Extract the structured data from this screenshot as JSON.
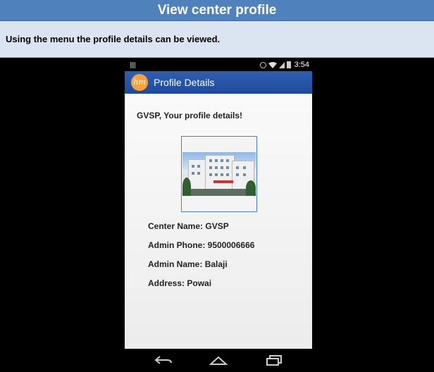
{
  "slide": {
    "title": "View center profile",
    "description": "Using the menu the profile details can be viewed."
  },
  "status_bar": {
    "time": "3:54",
    "icons": [
      "barcode-icon",
      "alarm-icon",
      "wifi-icon",
      "signal-icon",
      "battery-icon"
    ]
  },
  "action_bar": {
    "logo_text": "hm",
    "title": "Profile Details"
  },
  "profile": {
    "greeting": "GVSP, Your profile details!",
    "details": [
      {
        "label": "Center Name:",
        "value": "GVSP"
      },
      {
        "label": "Admin Phone:",
        "value": "9500006666"
      },
      {
        "label": "Admin Name:",
        "value": "Balaji"
      },
      {
        "label": "Address:",
        "value": "Powai"
      }
    ]
  },
  "nav_bar": {
    "buttons": [
      "back-icon",
      "home-icon",
      "recent-apps-icon"
    ]
  },
  "colors": {
    "title_bar": "#4f81bd",
    "desc_bar": "#dbe5f1",
    "action_bar": "#2a57a8",
    "logo": "#f7a23a"
  }
}
